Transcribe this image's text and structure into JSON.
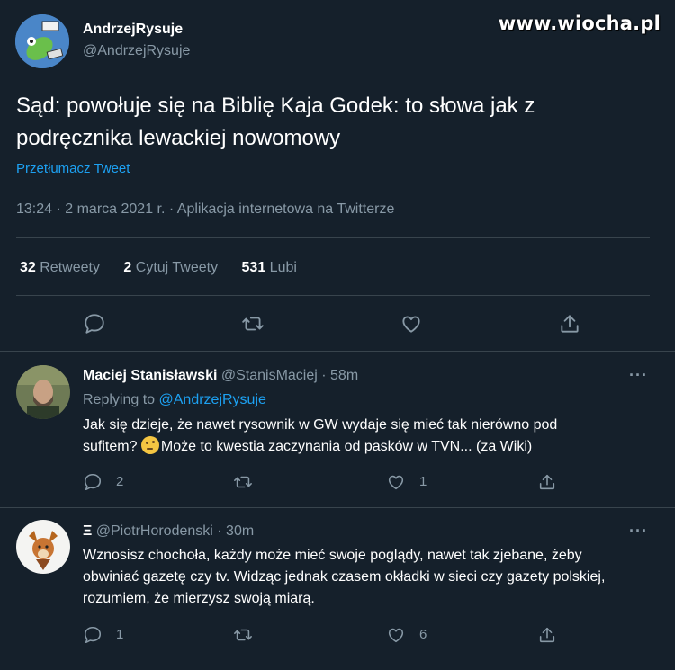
{
  "watermark": "www.wiocha.pl",
  "tweet": {
    "author_name": "AndrzejRysuje",
    "author_handle": "@AndrzejRysuje",
    "text": "Sąd: powołuje się na Biblię Kaja Godek: to słowa jak z podręcznika lewackiej nowomowy",
    "translate_label": "Przetłumacz Tweet",
    "meta": "13:24 · 2 marca 2021 r.  ·  Aplikacja internetowa na Twitterze",
    "stats": {
      "retweets_count": "32",
      "retweets_label": "Retweety",
      "quotes_count": "2",
      "quotes_label": "Cytuj Tweety",
      "likes_count": "531",
      "likes_label": "Lubi"
    }
  },
  "replies": [
    {
      "name": "Maciej Stanisławski",
      "meta": "@StanisMaciej · 58m",
      "replying_prefix": "Replying to",
      "replying_handle": "@AndrzejRysuje",
      "text_line1": "Jak się dzieje, że nawet rysownik w GW wydaje się mieć tak nierówno pod",
      "text_line2_a": "sufitem?",
      "text_line2_b": "Może to kwestia zaczynania od pasków w TVN... (za Wiki)",
      "reply_count": "2",
      "like_count": "1",
      "more": "···"
    },
    {
      "name": "Ξ",
      "meta": "@PiotrHorodenski · 30m",
      "text": "Wznosisz chochoła, każdy może mieć swoje poglądy, nawet tak zjebane, żeby obwiniać gazetę czy tv. Widząc jednak czasem okładki w sieci czy gazety polskiej, rozumiem, że mierzysz swoją miarą.",
      "reply_count": "1",
      "like_count": "6",
      "more": "···"
    }
  ],
  "icons": [
    "reply-icon",
    "retweet-icon",
    "like-icon",
    "share-icon"
  ],
  "colors": {
    "background": "#15202b",
    "accent": "#1da1f2",
    "muted": "#8899a6",
    "border": "#38444d"
  }
}
